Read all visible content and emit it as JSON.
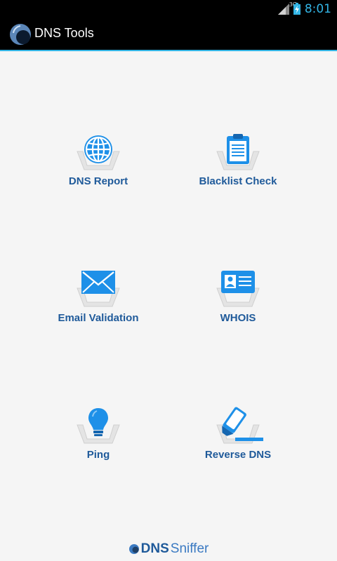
{
  "status_bar": {
    "network_type": "3G",
    "time": "8:01",
    "clock_color": "#33b5e5"
  },
  "action_bar": {
    "title": "DNS Tools",
    "accent_color": "#33b5e5"
  },
  "tools": [
    {
      "label": "DNS Report",
      "icon": "globe-icon"
    },
    {
      "label": "Blacklist Check",
      "icon": "clipboard-icon"
    },
    {
      "label": "Email Validation",
      "icon": "envelope-icon"
    },
    {
      "label": "WHOIS",
      "icon": "id-card-icon"
    },
    {
      "label": "Ping",
      "icon": "lightbulb-icon"
    },
    {
      "label": "Reverse DNS",
      "icon": "highlighter-icon"
    }
  ],
  "footer": {
    "brand_strong": "DNS",
    "brand_light": "Sniffer"
  },
  "colors": {
    "label": "#1f5a9a",
    "icon": "#1e90e8",
    "background": "#f5f5f5"
  }
}
